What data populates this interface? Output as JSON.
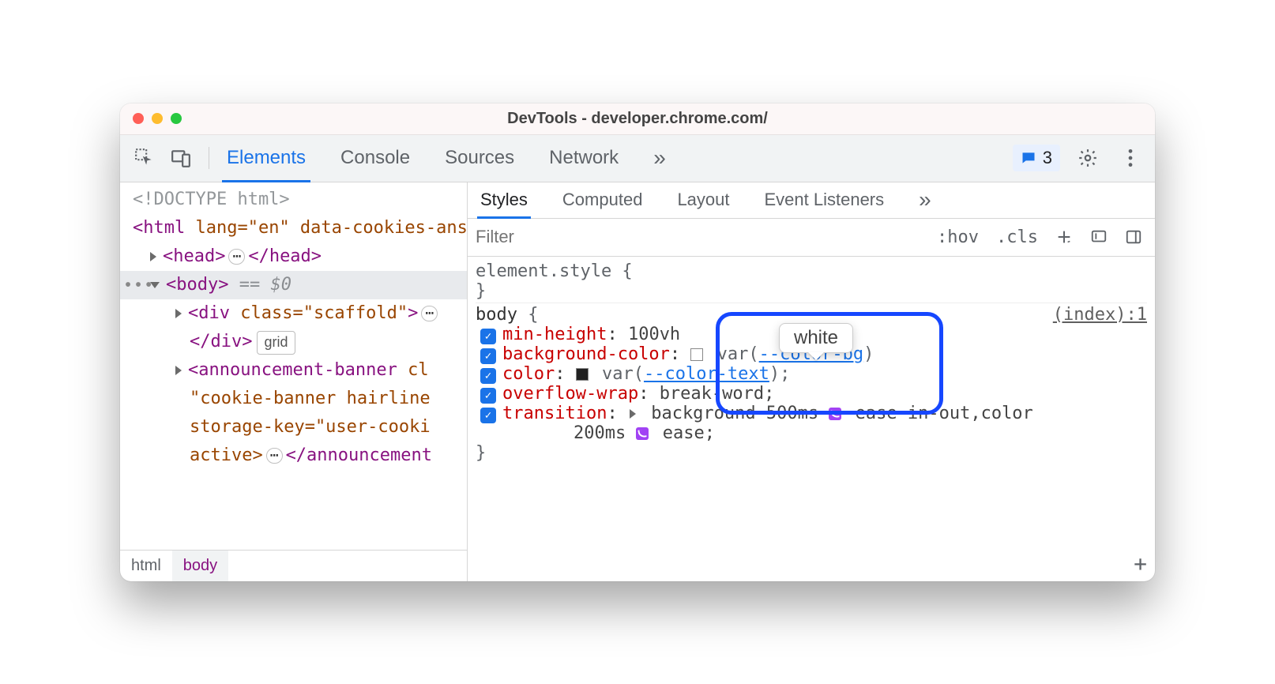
{
  "window": {
    "title": "DevTools - developer.chrome.com/"
  },
  "toolbar": {
    "tabs": [
      "Elements",
      "Console",
      "Sources",
      "Network"
    ],
    "active_tab_index": 0,
    "overflow_glyph": "»",
    "issues_count": "3"
  },
  "dom": {
    "doctype": "<!DOCTYPE html>",
    "html_open": {
      "tag": "html",
      "attrs_text": " lang=\"en\" data-cookies-answered data-banner-dismissed"
    },
    "head": {
      "open": "<head>",
      "close": "</head>"
    },
    "body_selected_suffix": " == $0",
    "div_scaffold": {
      "open_attr": " class=\"scaffold\"",
      "open_tag": "div",
      "close": "</div>",
      "badge": "grid"
    },
    "announcement": {
      "open_tag": "announcement-banner",
      "attr_start": " cl",
      "line2": "\"cookie-banner hairline",
      "line3": "storage-key=\"user-cooki",
      "line4_prefix": "active>",
      "close_frag": "</announcement"
    }
  },
  "breadcrumb": [
    "html",
    "body"
  ],
  "subtabs": {
    "items": [
      "Styles",
      "Computed",
      "Layout",
      "Event Listeners"
    ],
    "active_index": 0,
    "overflow_glyph": "»"
  },
  "filter": {
    "placeholder": "Filter",
    "hov": ":hov",
    "cls": ".cls"
  },
  "styles": {
    "element_style_selector": "element.style",
    "open_brace": " {",
    "close_brace": "}",
    "body_selector": "body",
    "source": "(index):1",
    "decls": [
      {
        "prop": "min-height",
        "value": "100vh"
      },
      {
        "prop": "background-color",
        "value_pre": "var(",
        "var_name": "--color-bg",
        "value_post": ")",
        "swatch": "white"
      },
      {
        "prop": "color",
        "value_pre": "var(",
        "var_name": "--color-text",
        "value_post": ");",
        "swatch": "black"
      },
      {
        "prop": "overflow-wrap",
        "value": "break-word;"
      },
      {
        "prop": "transition",
        "seg1": "background 500ms ",
        "ease1": "ease-in-out",
        "mid": ",color",
        "seg2": "200ms ",
        "ease2": "ease;"
      }
    ]
  },
  "tooltip": {
    "text": "white"
  }
}
